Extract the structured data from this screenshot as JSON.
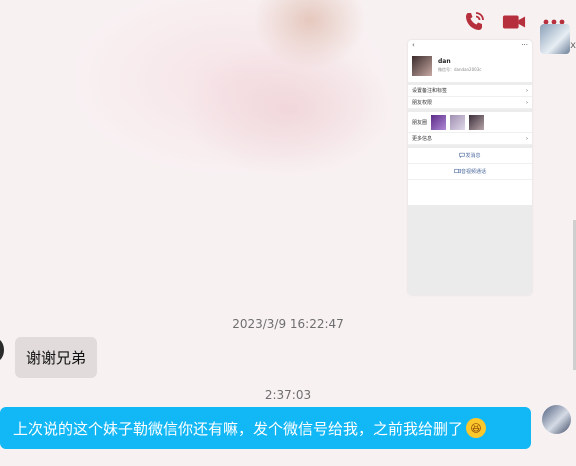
{
  "header": {
    "icons": [
      "phone-call-icon",
      "video-call-icon",
      "more-options-icon"
    ],
    "accent_color": "#b5303c",
    "avatar_mark": "x"
  },
  "shared_screenshot": {
    "back_glyph": "‹",
    "more_glyph": "···",
    "name": "dan",
    "id_line": "微信号：dandan2003c",
    "row_remark": "设置备注和标签",
    "row_permission": "朋友权限",
    "row_moments": "朋友圈",
    "row_more": "更多信息",
    "action_message": "发消息",
    "action_video": "音视频通话",
    "chevron": "›"
  },
  "messages": {
    "timestamp_1": "2023/3/9 16:22:47",
    "incoming_1": "谢谢兄弟",
    "timestamp_2": "2:37:03",
    "outgoing_1": "上次说的这个妹子勒微信你还有嘛，发个微信号给我，之前我给删了",
    "outgoing_emoji": "laughing-emoji"
  },
  "colors": {
    "bubble_out": "#12b7f5",
    "bubble_in": "#e1dcdb",
    "background": "#f8f1f2"
  }
}
